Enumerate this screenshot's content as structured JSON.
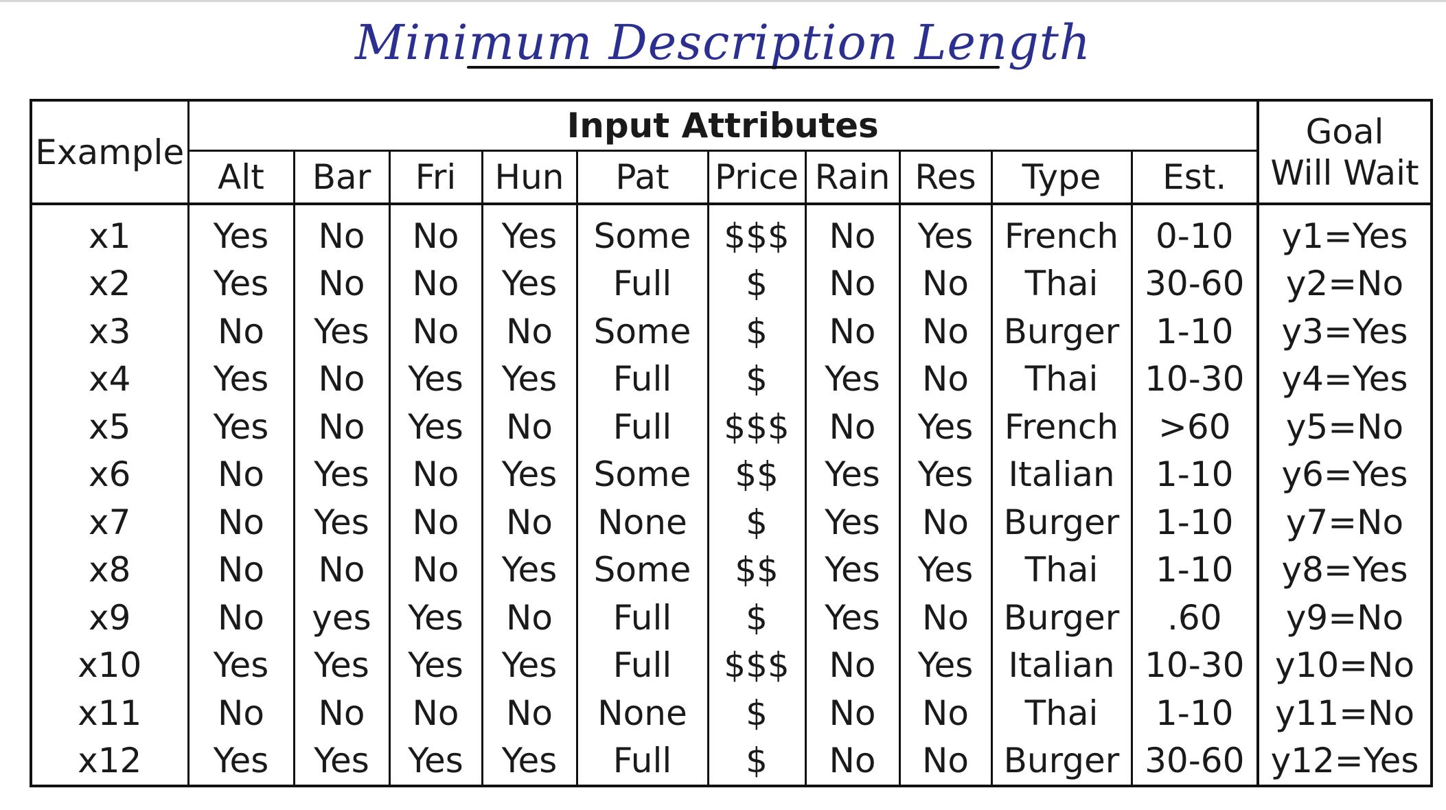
{
  "title": "Minimum Description Length",
  "table": {
    "example_header": "Example",
    "group_header": "Input Attributes",
    "goal_header_line1": "Goal",
    "goal_header_line2": "Will Wait",
    "attribute_headers": [
      "Alt",
      "Bar",
      "Fri",
      "Hun",
      "Pat",
      "Price",
      "Rain",
      "Res",
      "Type",
      "Est."
    ],
    "rows": [
      {
        "example": "x1",
        "values": [
          "Yes",
          "No",
          "No",
          "Yes",
          "Some",
          "$$$",
          "No",
          "Yes",
          "French",
          "0-10"
        ],
        "goal": "y1=Yes"
      },
      {
        "example": "x2",
        "values": [
          "Yes",
          "No",
          "No",
          "Yes",
          "Full",
          "$",
          "No",
          "No",
          "Thai",
          "30-60"
        ],
        "goal": "y2=No"
      },
      {
        "example": "x3",
        "values": [
          "No",
          "Yes",
          "No",
          "No",
          "Some",
          "$",
          "No",
          "No",
          "Burger",
          "1-10"
        ],
        "goal": "y3=Yes"
      },
      {
        "example": "x4",
        "values": [
          "Yes",
          "No",
          "Yes",
          "Yes",
          "Full",
          "$",
          "Yes",
          "No",
          "Thai",
          "10-30"
        ],
        "goal": "y4=Yes"
      },
      {
        "example": "x5",
        "values": [
          "Yes",
          "No",
          "Yes",
          "No",
          "Full",
          "$$$",
          "No",
          "Yes",
          "French",
          ">60"
        ],
        "goal": "y5=No"
      },
      {
        "example": "x6",
        "values": [
          "No",
          "Yes",
          "No",
          "Yes",
          "Some",
          "$$",
          "Yes",
          "Yes",
          "Italian",
          "1-10"
        ],
        "goal": "y6=Yes"
      },
      {
        "example": "x7",
        "values": [
          "No",
          "Yes",
          "No",
          "No",
          "None",
          "$",
          "Yes",
          "No",
          "Burger",
          "1-10"
        ],
        "goal": "y7=No"
      },
      {
        "example": "x8",
        "values": [
          "No",
          "No",
          "No",
          "Yes",
          "Some",
          "$$",
          "Yes",
          "Yes",
          "Thai",
          "1-10"
        ],
        "goal": "y8=Yes"
      },
      {
        "example": "x9",
        "values": [
          "No",
          "yes",
          "Yes",
          "No",
          "Full",
          "$",
          "Yes",
          "No",
          "Burger",
          ".60"
        ],
        "goal": "y9=No"
      },
      {
        "example": "x10",
        "values": [
          "Yes",
          "Yes",
          "Yes",
          "Yes",
          "Full",
          "$$$",
          "No",
          "Yes",
          "Italian",
          "10-30"
        ],
        "goal": "y10=No"
      },
      {
        "example": "x11",
        "values": [
          "No",
          "No",
          "No",
          "No",
          "None",
          "$",
          "No",
          "No",
          "Thai",
          "1-10"
        ],
        "goal": "y11=No"
      },
      {
        "example": "x12",
        "values": [
          "Yes",
          "Yes",
          "Yes",
          "Yes",
          "Full",
          "$",
          "No",
          "No",
          "Burger",
          "30-60"
        ],
        "goal": "y12=Yes"
      }
    ]
  }
}
